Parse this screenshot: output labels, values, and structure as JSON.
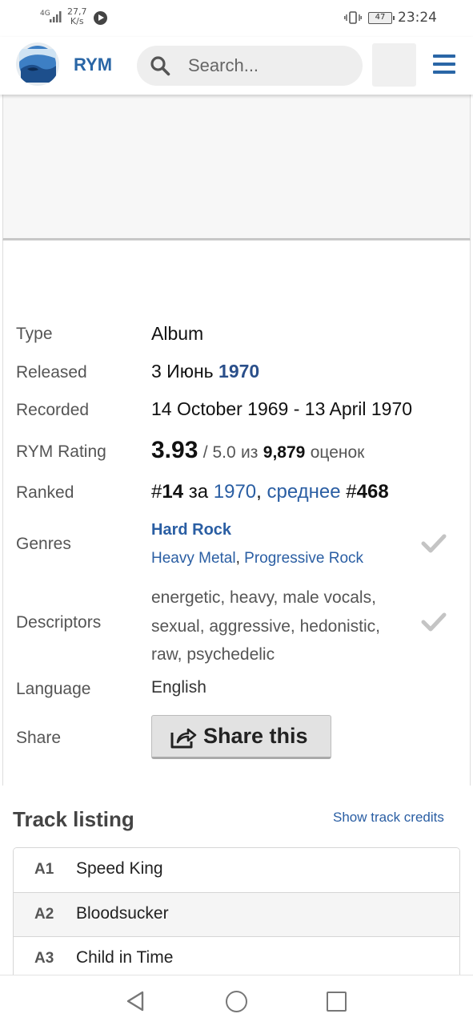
{
  "status_bar": {
    "network": "4G",
    "speed_value": "27,7",
    "speed_unit": "K/s",
    "battery": "47",
    "time": "23:24"
  },
  "header": {
    "brand": "RYM",
    "search_placeholder": "Search..."
  },
  "album_info": {
    "type_label": "Type",
    "type_value": "Album",
    "released_label": "Released",
    "released_date": "3 Июнь",
    "released_year": "1970",
    "recorded_label": "Recorded",
    "recorded_value": "14 October 1969 - 13 April 1970",
    "rating_label": "RYM Rating",
    "rating_value": "3.93",
    "rating_scale": "/ 5.0",
    "rating_from": "из",
    "rating_count": "9,879",
    "rating_count_label": "оценок",
    "ranked_label": "Ranked",
    "ranked_prefix": "#",
    "ranked_year_rank": "14",
    "ranked_for": "за",
    "ranked_year": "1970",
    "ranked_overall_label": "среднее",
    "ranked_overall_rank": "468",
    "genres_label": "Genres",
    "genre_primary": "Hard Rock",
    "genre_secondary_1": "Heavy Metal",
    "genre_secondary_2": "Progressive Rock",
    "descriptors_label": "Descriptors",
    "descriptors_value": "energetic, heavy, male vocals, sexual, aggressive, hedonistic, raw, psychedelic",
    "language_label": "Language",
    "language_value": "English",
    "share_label": "Share",
    "share_button": "Share this"
  },
  "tracklist": {
    "heading": "Track listing",
    "credits_link": "Show track credits",
    "tracks": [
      {
        "num": "A1",
        "title": "Speed King"
      },
      {
        "num": "A2",
        "title": "Bloodsucker"
      },
      {
        "num": "A3",
        "title": "Child in Time"
      }
    ]
  },
  "colors": {
    "brand_blue": "#2a66a6",
    "link_blue": "#2a5ea3"
  }
}
